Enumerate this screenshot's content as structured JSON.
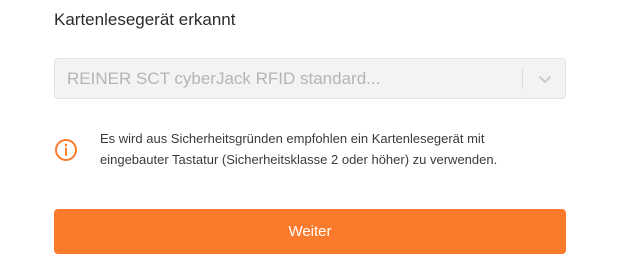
{
  "heading": "Kartenlesegerät erkannt",
  "reader_select": {
    "selected_value": "REINER SCT cyberJack RFID standard..."
  },
  "notice": {
    "icon": "info-icon",
    "line1": "Es wird aus Sicherheitsgründen empfohlen ein Kartenlesegerät mit",
    "line2": "eingebauter Tastatur (Sicherheitsklasse 2 oder höher) zu verwenden."
  },
  "continue_button": {
    "label": "Weiter"
  },
  "colors": {
    "accent": "#fb7a2c",
    "select_background": "#f3f3f3",
    "select_text": "#b5b5b5"
  }
}
